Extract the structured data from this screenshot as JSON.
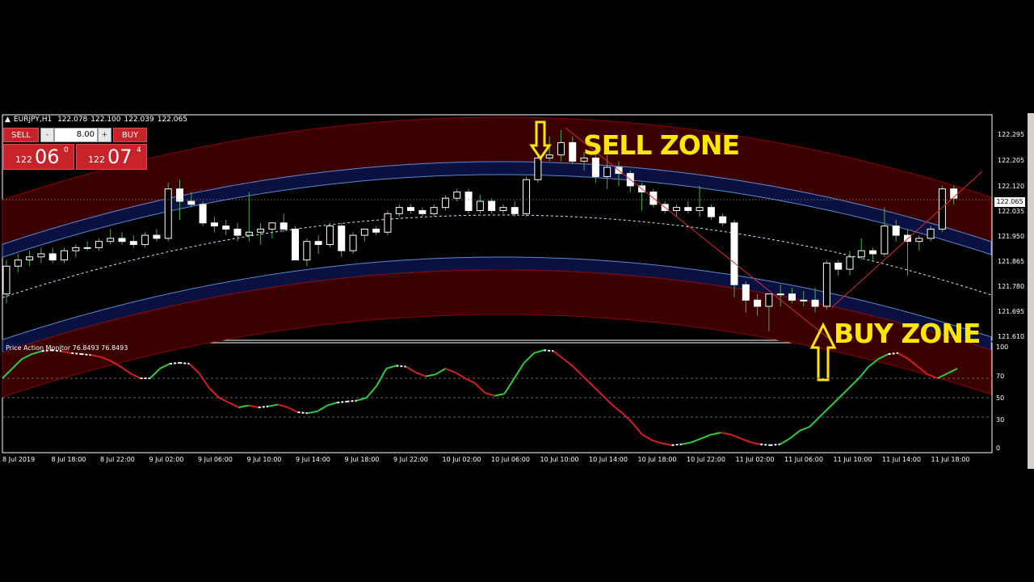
{
  "header": {
    "symbol_timeframe": "EURJPY,H1",
    "ohlc": [
      "122.078",
      "122.100",
      "122.039",
      "122.065"
    ]
  },
  "trade_panel": {
    "sell_label": "SELL",
    "buy_label": "BUY",
    "lot_minus": "-",
    "lot_plus": "+",
    "lot_value": "8.00",
    "sell_price_prefix": "122",
    "sell_price_big": "06",
    "sell_price_sup": "0",
    "buy_price_prefix": "122",
    "buy_price_big": "07",
    "buy_price_sup": "4"
  },
  "annotations": {
    "sell_zone": "SELL ZONE",
    "buy_zone": "BUY ZONE",
    "arrow_color": "#ffe600"
  },
  "colors": {
    "background": "#000000",
    "bull_candle": "#ffffff",
    "bear_candle": "#ffffff",
    "wick": "#4caf50",
    "outer_band": "#3a0000",
    "inner_band": "#0a1040",
    "osc_up": "#2ecc40",
    "osc_down": "#d42020",
    "osc_flat": "#ffffff"
  },
  "price_axis": {
    "labels": [
      "122.295",
      "122.205",
      "122.120",
      "122.035",
      "121.950",
      "121.865",
      "121.780",
      "121.695",
      "121.610"
    ],
    "current_price": "122.065"
  },
  "indicator": {
    "label": "Price Action Monitor 76.8493 76.8493",
    "scale_labels": [
      "100",
      "70",
      "50",
      "30",
      "0"
    ]
  },
  "time_axis": {
    "labels": [
      "8 Jul 2019",
      "8 Jul 18:00",
      "8 Jul 22:00",
      "9 Jul 02:00",
      "9 Jul 06:00",
      "9 Jul 10:00",
      "9 Jul 14:00",
      "9 Jul 18:00",
      "9 Jul 22:00",
      "10 Jul 02:00",
      "10 Jul 06:00",
      "10 Jul 10:00",
      "10 Jul 14:00",
      "10 Jul 18:00",
      "10 Jul 22:00",
      "11 Jul 02:00",
      "11 Jul 06:00",
      "11 Jul 10:00",
      "11 Jul 14:00",
      "11 Jul 18:00"
    ]
  },
  "chart_data": [
    {
      "type": "candlestick",
      "symbol": "EURJPY",
      "timeframe": "H1",
      "ylim": [
        121.61,
        122.34
      ],
      "ohlc": [
        [
          121.76,
          121.87,
          121.73,
          121.85
        ],
        [
          121.85,
          121.89,
          121.83,
          121.87
        ],
        [
          121.87,
          121.9,
          121.85,
          121.88
        ],
        [
          121.88,
          121.91,
          121.86,
          121.89
        ],
        [
          121.89,
          121.91,
          121.86,
          121.87
        ],
        [
          121.87,
          121.91,
          121.86,
          121.9
        ],
        [
          121.9,
          121.92,
          121.88,
          121.91
        ],
        [
          121.91,
          121.93,
          121.9,
          121.91
        ],
        [
          121.91,
          121.94,
          121.9,
          121.93
        ],
        [
          121.93,
          121.97,
          121.92,
          121.94
        ],
        [
          121.94,
          121.96,
          121.92,
          121.93
        ],
        [
          121.93,
          121.95,
          121.91,
          121.92
        ],
        [
          121.92,
          121.96,
          121.91,
          121.95
        ],
        [
          121.95,
          121.97,
          121.93,
          121.94
        ],
        [
          121.94,
          122.12,
          121.93,
          122.1
        ],
        [
          122.1,
          122.13,
          122.0,
          122.06
        ],
        [
          122.06,
          122.09,
          122.04,
          122.05
        ],
        [
          122.05,
          122.06,
          121.98,
          121.99
        ],
        [
          121.99,
          122.01,
          121.96,
          121.98
        ],
        [
          121.98,
          122.0,
          121.95,
          121.97
        ],
        [
          121.97,
          121.99,
          121.93,
          121.95
        ],
        [
          121.95,
          122.09,
          121.93,
          121.96
        ],
        [
          121.96,
          121.99,
          121.92,
          121.97
        ],
        [
          121.97,
          121.99,
          121.94,
          121.99
        ],
        [
          121.99,
          122.02,
          121.96,
          121.97
        ],
        [
          121.97,
          121.98,
          121.87,
          121.87
        ],
        [
          121.87,
          121.94,
          121.85,
          121.93
        ],
        [
          121.93,
          121.95,
          121.89,
          121.92
        ],
        [
          121.92,
          121.99,
          121.91,
          121.98
        ],
        [
          121.98,
          121.99,
          121.88,
          121.9
        ],
        [
          121.9,
          121.96,
          121.89,
          121.95
        ],
        [
          121.95,
          121.97,
          121.93,
          121.97
        ],
        [
          121.97,
          121.98,
          121.95,
          121.96
        ],
        [
          121.96,
          122.03,
          121.95,
          122.02
        ],
        [
          122.02,
          122.05,
          122.01,
          122.04
        ],
        [
          122.04,
          122.05,
          122.02,
          122.03
        ],
        [
          122.03,
          122.04,
          122.01,
          122.02
        ],
        [
          122.02,
          122.05,
          122.01,
          122.04
        ],
        [
          122.04,
          122.08,
          122.03,
          122.07
        ],
        [
          122.07,
          122.1,
          122.06,
          122.09
        ],
        [
          122.09,
          122.1,
          122.02,
          122.03
        ],
        [
          122.03,
          122.08,
          122.02,
          122.06
        ],
        [
          122.06,
          122.07,
          122.02,
          122.03
        ],
        [
          122.03,
          122.05,
          122.02,
          122.04
        ],
        [
          122.04,
          122.06,
          122.01,
          122.02
        ],
        [
          122.02,
          122.14,
          122.01,
          122.13
        ],
        [
          122.13,
          122.21,
          122.12,
          122.2
        ],
        [
          122.2,
          122.27,
          122.19,
          122.21
        ],
        [
          122.21,
          122.29,
          122.19,
          122.25
        ],
        [
          122.25,
          122.27,
          122.18,
          122.19
        ],
        [
          122.19,
          122.22,
          122.16,
          122.2
        ],
        [
          122.2,
          122.21,
          122.12,
          122.14
        ],
        [
          122.14,
          122.21,
          122.1,
          122.17
        ],
        [
          122.17,
          122.19,
          122.11,
          122.15
        ],
        [
          122.15,
          122.16,
          122.09,
          122.11
        ],
        [
          122.11,
          122.12,
          122.03,
          122.09
        ],
        [
          122.09,
          122.1,
          122.04,
          122.05
        ],
        [
          122.05,
          122.06,
          122.02,
          122.03
        ],
        [
          122.03,
          122.05,
          122.01,
          122.04
        ],
        [
          122.04,
          122.06,
          122.02,
          122.03
        ],
        [
          122.03,
          122.11,
          122.01,
          122.04
        ],
        [
          122.04,
          122.05,
          122.0,
          122.01
        ],
        [
          122.01,
          122.02,
          121.98,
          121.99
        ],
        [
          121.99,
          122.0,
          121.75,
          121.79
        ],
        [
          121.79,
          121.8,
          121.7,
          121.74
        ],
        [
          121.74,
          121.76,
          121.69,
          121.72
        ],
        [
          121.72,
          121.75,
          121.64,
          121.76
        ],
        [
          121.76,
          121.79,
          121.72,
          121.76
        ],
        [
          121.76,
          121.78,
          121.73,
          121.74
        ],
        [
          121.74,
          121.77,
          121.72,
          121.74
        ],
        [
          121.74,
          121.78,
          121.7,
          121.72
        ],
        [
          121.72,
          121.87,
          121.71,
          121.86
        ],
        [
          121.86,
          121.87,
          121.82,
          121.84
        ],
        [
          121.84,
          121.9,
          121.82,
          121.88
        ],
        [
          121.88,
          121.94,
          121.87,
          121.9
        ],
        [
          121.9,
          121.91,
          121.87,
          121.89
        ],
        [
          121.89,
          122.04,
          121.88,
          121.98
        ],
        [
          121.98,
          122.0,
          121.93,
          121.95
        ],
        [
          121.95,
          121.97,
          121.82,
          121.93
        ],
        [
          121.93,
          121.95,
          121.9,
          121.94
        ],
        [
          121.94,
          121.98,
          121.93,
          121.97
        ],
        [
          121.97,
          122.11,
          121.96,
          122.1
        ],
        [
          122.1,
          122.11,
          122.05,
          122.07
        ]
      ],
      "current_price": 122.065
    },
    {
      "type": "line",
      "name": "Price Action Monitor",
      "ylim": [
        0,
        100
      ],
      "levels": [
        70,
        50,
        30
      ],
      "values": [
        70,
        80,
        90,
        95,
        98,
        99,
        98,
        96,
        95,
        94,
        92,
        88,
        82,
        75,
        70,
        70,
        80,
        85,
        86,
        85,
        75,
        60,
        50,
        45,
        40,
        42,
        40,
        41,
        43,
        40,
        35,
        34,
        36,
        42,
        45,
        46,
        47,
        50,
        62,
        80,
        83,
        82,
        76,
        72,
        74,
        80,
        76,
        70,
        65,
        55,
        52,
        54,
        70,
        86,
        96,
        99,
        98,
        90,
        82,
        72,
        62,
        52,
        42,
        34,
        24,
        12,
        6,
        3,
        1,
        2,
        4,
        8,
        12,
        14,
        12,
        8,
        4,
        2,
        1,
        2,
        8,
        16,
        20,
        30,
        40,
        50,
        60,
        70,
        82,
        90,
        95,
        96,
        90,
        82,
        74,
        70,
        75,
        80
      ]
    }
  ]
}
